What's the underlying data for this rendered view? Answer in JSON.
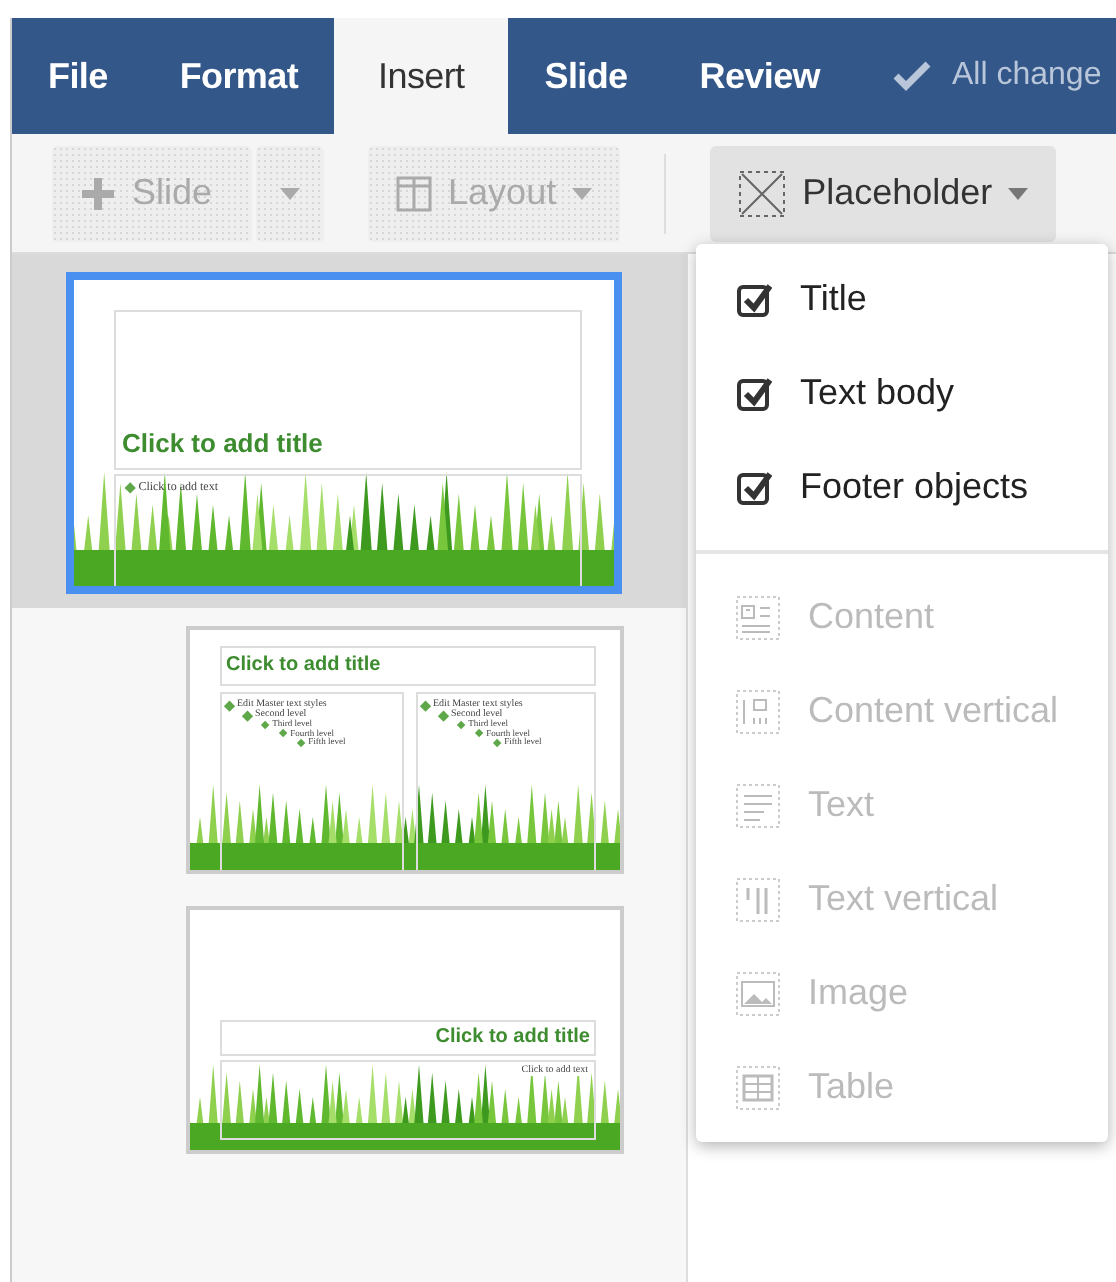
{
  "menu_tabs": [
    {
      "label": "File",
      "selected": false
    },
    {
      "label": "Format",
      "selected": false
    },
    {
      "label": "Insert",
      "selected": true
    },
    {
      "label": "Slide",
      "selected": false
    },
    {
      "label": "Review",
      "selected": false
    }
  ],
  "save_status": "All change",
  "toolbar": [
    {
      "kind": "split",
      "label": "Slide",
      "disabled": true,
      "expanded": false
    },
    {
      "kind": "button",
      "label": "Layout",
      "disabled": true,
      "expanded": false
    },
    {
      "kind": "button",
      "label": "Placeholder",
      "disabled": false,
      "expanded": true
    }
  ],
  "slides": [
    {
      "selected": true,
      "kind": "title",
      "title": "Click to add title",
      "body": [
        "Click to add text"
      ]
    },
    {
      "selected": false,
      "kind": "two_content",
      "title": "Click to add title",
      "columns": [
        [
          "Edit Master text styles",
          "Second level",
          "Third level",
          "Fourth level",
          "Fifth level"
        ],
        [
          "Edit Master text styles",
          "Second level",
          "Third level",
          "Fourth level",
          "Fifth level"
        ]
      ]
    },
    {
      "selected": false,
      "kind": "section",
      "title": "Click to add title",
      "body": [
        "Click to add text"
      ]
    }
  ],
  "placeholder_menu": [
    {
      "kind": "check",
      "label": "Title",
      "checked": true
    },
    {
      "kind": "check",
      "label": "Text body",
      "checked": true
    },
    {
      "kind": "check",
      "label": "Footer objects",
      "checked": true
    },
    {
      "kind": "insert",
      "label": "Content",
      "disabled": true
    },
    {
      "kind": "insert",
      "label": "Content vertical",
      "disabled": true
    },
    {
      "kind": "insert",
      "label": "Text",
      "disabled": true
    },
    {
      "kind": "insert",
      "label": "Text vertical",
      "disabled": true
    },
    {
      "kind": "insert",
      "label": "Image",
      "disabled": true
    },
    {
      "kind": "insert",
      "label": "Table",
      "disabled": true
    }
  ]
}
